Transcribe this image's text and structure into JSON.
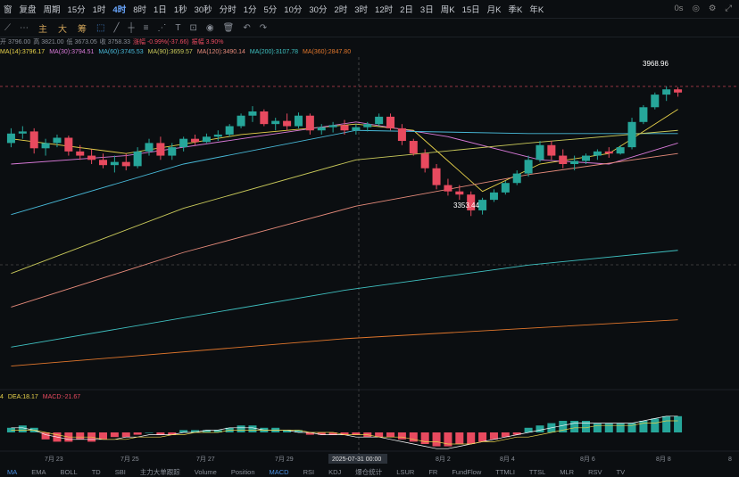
{
  "timeframes": {
    "items": [
      "窗",
      "复盘",
      "周期",
      "",
      "15分",
      "1时",
      "4时",
      "8时",
      "1日",
      "1秒",
      "30秒",
      "分时",
      "1分",
      "5分",
      "10分",
      "30分",
      "2时",
      "3时",
      "12时",
      "2日",
      "3日",
      "周K",
      "15日",
      "月K",
      "季K",
      "年K"
    ],
    "active_index": 6,
    "right_items": [
      "0s",
      "camera-icon",
      "settings-icon",
      "expand-icon"
    ]
  },
  "toolbar": {
    "indicators": [
      "主",
      "大",
      "筹"
    ]
  },
  "ohlc": {
    "open": "开 3796.00",
    "high": "高 3821.00",
    "low": "低 3673.05",
    "close": "收 3758.33",
    "change": "涨幅 -0.99%(-37.66)",
    "amp": "振幅 3.90%"
  },
  "ma_legend": [
    {
      "label": "MA(14):3796.17",
      "color": "#e8d24a"
    },
    {
      "label": "MA(30):3794.51",
      "color": "#d97ad9"
    },
    {
      "label": "MA(60):3745.53",
      "color": "#48b9d8"
    },
    {
      "label": "MA(90):3659.57",
      "color": "#c9c95a"
    },
    {
      "label": "MA(120):3490.14",
      "color": "#e58a7a"
    },
    {
      "label": "MA(200):3107.78",
      "color": "#3fc1c1"
    },
    {
      "label": "MA(360):2847.80",
      "color": "#e0762c"
    }
  ],
  "macd_legend": [
    {
      "label": "4",
      "color": "#e8d24a"
    },
    {
      "label": "DEA:18.17",
      "color": "#e8d24a"
    },
    {
      "label": "MACD:-21.67",
      "color": "#e84a5f"
    }
  ],
  "annotations": {
    "high_label": "3968.96",
    "low_label": "3353.44",
    "crosshair_time": "2025-07-31 00:00"
  },
  "x_axis_labels": [
    "7月 23",
    "7月 25",
    "7月 27",
    "7月 29",
    "8月 2",
    "8月 4",
    "8月 6",
    "8月 8",
    "8"
  ],
  "bottom_tabs": {
    "items": [
      "MA",
      "EMA",
      "BOLL",
      "TD",
      "SBI",
      "主力大单跟踪",
      "Volume",
      "Position",
      "MACD",
      "RSI",
      "KDJ",
      "爆仓统计",
      "LSUR",
      "FR",
      "FundFlow",
      "TTMLI",
      "TTSL",
      "MLR",
      "RSV",
      "TV"
    ],
    "active": [
      "MA",
      "MACD"
    ]
  },
  "colors": {
    "up": "#26a69a",
    "down": "#e84a5f",
    "accent": "#4a90e2"
  },
  "chart_data": {
    "type": "candlestick",
    "interval": "4h",
    "price_range": [
      2600,
      4100
    ],
    "price_min_label": "3353.44",
    "price_max_label": "3968.96",
    "candles": [
      {
        "t": "7月 22",
        "o": 3700,
        "h": 3770,
        "l": 3680,
        "c": 3745
      },
      {
        "t": "7月 22",
        "o": 3745,
        "h": 3780,
        "l": 3720,
        "c": 3755
      },
      {
        "t": "7月 23",
        "o": 3755,
        "h": 3770,
        "l": 3650,
        "c": 3675
      },
      {
        "t": "7月 23",
        "o": 3675,
        "h": 3720,
        "l": 3640,
        "c": 3700
      },
      {
        "t": "7月 23",
        "o": 3700,
        "h": 3740,
        "l": 3680,
        "c": 3725
      },
      {
        "t": "7月 23",
        "o": 3725,
        "h": 3735,
        "l": 3640,
        "c": 3660
      },
      {
        "t": "7月 24",
        "o": 3660,
        "h": 3690,
        "l": 3620,
        "c": 3640
      },
      {
        "t": "7月 24",
        "o": 3640,
        "h": 3670,
        "l": 3600,
        "c": 3620
      },
      {
        "t": "7月 24",
        "o": 3620,
        "h": 3650,
        "l": 3580,
        "c": 3595
      },
      {
        "t": "7月 24",
        "o": 3595,
        "h": 3640,
        "l": 3560,
        "c": 3610
      },
      {
        "t": "7月 25",
        "o": 3610,
        "h": 3650,
        "l": 3570,
        "c": 3590
      },
      {
        "t": "7月 25",
        "o": 3590,
        "h": 3680,
        "l": 3580,
        "c": 3660
      },
      {
        "t": "7月 25",
        "o": 3660,
        "h": 3720,
        "l": 3640,
        "c": 3700
      },
      {
        "t": "7月 25",
        "o": 3700,
        "h": 3730,
        "l": 3620,
        "c": 3640
      },
      {
        "t": "7月 26",
        "o": 3640,
        "h": 3700,
        "l": 3620,
        "c": 3680
      },
      {
        "t": "7月 26",
        "o": 3680,
        "h": 3730,
        "l": 3660,
        "c": 3720
      },
      {
        "t": "7月 26",
        "o": 3720,
        "h": 3740,
        "l": 3690,
        "c": 3705
      },
      {
        "t": "7月 26",
        "o": 3705,
        "h": 3745,
        "l": 3700,
        "c": 3730
      },
      {
        "t": "7月 27",
        "o": 3730,
        "h": 3760,
        "l": 3710,
        "c": 3740
      },
      {
        "t": "7月 27",
        "o": 3740,
        "h": 3790,
        "l": 3730,
        "c": 3780
      },
      {
        "t": "7月 27",
        "o": 3780,
        "h": 3840,
        "l": 3770,
        "c": 3830
      },
      {
        "t": "7月 28",
        "o": 3830,
        "h": 3875,
        "l": 3800,
        "c": 3850
      },
      {
        "t": "7月 28",
        "o": 3850,
        "h": 3860,
        "l": 3780,
        "c": 3790
      },
      {
        "t": "7月 28",
        "o": 3790,
        "h": 3820,
        "l": 3760,
        "c": 3805
      },
      {
        "t": "7月 29",
        "o": 3805,
        "h": 3840,
        "l": 3760,
        "c": 3780
      },
      {
        "t": "7月 29",
        "o": 3780,
        "h": 3845,
        "l": 3770,
        "c": 3830
      },
      {
        "t": "7月 29",
        "o": 3830,
        "h": 3840,
        "l": 3740,
        "c": 3760
      },
      {
        "t": "7月 30",
        "o": 3760,
        "h": 3790,
        "l": 3740,
        "c": 3775
      },
      {
        "t": "7月 30",
        "o": 3775,
        "h": 3800,
        "l": 3750,
        "c": 3785
      },
      {
        "t": "7月 30",
        "o": 3785,
        "h": 3810,
        "l": 3740,
        "c": 3760
      },
      {
        "t": "7月 31",
        "o": 3760,
        "h": 3790,
        "l": 3740,
        "c": 3775
      },
      {
        "t": "7月 31",
        "o": 3775,
        "h": 3800,
        "l": 3755,
        "c": 3790
      },
      {
        "t": "7月 31",
        "o": 3790,
        "h": 3840,
        "l": 3780,
        "c": 3825
      },
      {
        "t": "8月 1",
        "o": 3825,
        "h": 3840,
        "l": 3760,
        "c": 3770
      },
      {
        "t": "8月 1",
        "o": 3770,
        "h": 3790,
        "l": 3690,
        "c": 3710
      },
      {
        "t": "8月 1",
        "o": 3710,
        "h": 3720,
        "l": 3640,
        "c": 3650
      },
      {
        "t": "8月 2",
        "o": 3650,
        "h": 3670,
        "l": 3560,
        "c": 3580
      },
      {
        "t": "8月 2",
        "o": 3580,
        "h": 3600,
        "l": 3480,
        "c": 3500
      },
      {
        "t": "8月 2",
        "o": 3500,
        "h": 3530,
        "l": 3450,
        "c": 3470
      },
      {
        "t": "8月 3",
        "o": 3470,
        "h": 3500,
        "l": 3430,
        "c": 3455
      },
      {
        "t": "8月 3",
        "o": 3455,
        "h": 3470,
        "l": 3353,
        "c": 3380
      },
      {
        "t": "8月 3",
        "o": 3380,
        "h": 3440,
        "l": 3360,
        "c": 3430
      },
      {
        "t": "8月 4",
        "o": 3430,
        "h": 3480,
        "l": 3420,
        "c": 3465
      },
      {
        "t": "8月 4",
        "o": 3465,
        "h": 3520,
        "l": 3455,
        "c": 3510
      },
      {
        "t": "8月 4",
        "o": 3510,
        "h": 3570,
        "l": 3500,
        "c": 3555
      },
      {
        "t": "8月 5",
        "o": 3555,
        "h": 3640,
        "l": 3540,
        "c": 3620
      },
      {
        "t": "8月 5",
        "o": 3620,
        "h": 3710,
        "l": 3610,
        "c": 3690
      },
      {
        "t": "8月 5",
        "o": 3690,
        "h": 3710,
        "l": 3620,
        "c": 3640
      },
      {
        "t": "8月 6",
        "o": 3640,
        "h": 3670,
        "l": 3580,
        "c": 3600
      },
      {
        "t": "8月 6",
        "o": 3600,
        "h": 3640,
        "l": 3570,
        "c": 3615
      },
      {
        "t": "8月 6",
        "o": 3615,
        "h": 3650,
        "l": 3600,
        "c": 3640
      },
      {
        "t": "8月 7",
        "o": 3640,
        "h": 3670,
        "l": 3620,
        "c": 3660
      },
      {
        "t": "8月 7",
        "o": 3660,
        "h": 3680,
        "l": 3630,
        "c": 3650
      },
      {
        "t": "8月 7",
        "o": 3650,
        "h": 3690,
        "l": 3645,
        "c": 3680
      },
      {
        "t": "8月 8",
        "o": 3680,
        "h": 3820,
        "l": 3670,
        "c": 3800
      },
      {
        "t": "8月 8",
        "o": 3800,
        "h": 3880,
        "l": 3790,
        "c": 3870
      },
      {
        "t": "8月 8",
        "o": 3870,
        "h": 3940,
        "l": 3860,
        "c": 3930
      },
      {
        "t": "8月 9",
        "o": 3930,
        "h": 3968.96,
        "l": 3900,
        "c": 3955
      },
      {
        "t": "8月 9",
        "o": 3955,
        "h": 3965,
        "l": 3920,
        "c": 3940
      }
    ],
    "ma_series": [
      {
        "name": "MA(14)",
        "color": "#e8d24a",
        "values": [
          [
            0,
            3720
          ],
          [
            10,
            3650
          ],
          [
            20,
            3740
          ],
          [
            30,
            3790
          ],
          [
            35,
            3760
          ],
          [
            41,
            3470
          ],
          [
            46,
            3600
          ],
          [
            52,
            3650
          ],
          [
            58,
            3860
          ]
        ]
      },
      {
        "name": "MA(30)",
        "color": "#d97ad9",
        "values": [
          [
            0,
            3600
          ],
          [
            10,
            3640
          ],
          [
            20,
            3720
          ],
          [
            30,
            3800
          ],
          [
            38,
            3730
          ],
          [
            46,
            3620
          ],
          [
            52,
            3600
          ],
          [
            58,
            3700
          ]
        ]
      },
      {
        "name": "MA(60)",
        "color": "#48b9d8",
        "values": [
          [
            0,
            3360
          ],
          [
            15,
            3600
          ],
          [
            30,
            3760
          ],
          [
            45,
            3745
          ],
          [
            58,
            3745
          ]
        ]
      },
      {
        "name": "MA(90)",
        "color": "#c9c95a",
        "values": [
          [
            0,
            3080
          ],
          [
            15,
            3390
          ],
          [
            30,
            3620
          ],
          [
            45,
            3700
          ],
          [
            58,
            3760
          ]
        ]
      },
      {
        "name": "MA(120)",
        "color": "#e58a7a",
        "values": [
          [
            0,
            2920
          ],
          [
            15,
            3180
          ],
          [
            30,
            3400
          ],
          [
            45,
            3550
          ],
          [
            58,
            3650
          ]
        ]
      },
      {
        "name": "MA(200)",
        "color": "#3fc1c1",
        "values": [
          [
            0,
            2730
          ],
          [
            29,
            3000
          ],
          [
            45,
            3120
          ],
          [
            58,
            3190
          ]
        ]
      },
      {
        "name": "MA(360)",
        "color": "#e0762c",
        "values": [
          [
            0,
            2640
          ],
          [
            29,
            2770
          ],
          [
            58,
            2860
          ]
        ]
      }
    ],
    "macd_hist": [
      2,
      3,
      2,
      -3,
      -4,
      -4,
      -3,
      -4,
      -3,
      -2,
      -2,
      -1,
      0,
      -1,
      -1,
      1,
      1,
      1,
      1,
      2,
      3,
      3,
      2,
      2,
      1,
      1,
      -1,
      -1,
      -1,
      -1,
      -1,
      -2,
      -2,
      -2,
      -3,
      -4,
      -5,
      -6,
      -6,
      -5,
      -5,
      -4,
      -3,
      -2,
      -1,
      2,
      3,
      4,
      5,
      5,
      5,
      4,
      4,
      4,
      4,
      5,
      6,
      7,
      7
    ],
    "dif": [
      2,
      2,
      1,
      -1,
      -2,
      -3,
      -3,
      -3,
      -3,
      -3,
      -2,
      -2,
      -1,
      -1,
      -1,
      0,
      0,
      1,
      1,
      2,
      2,
      2,
      1,
      1,
      1,
      0,
      0,
      -1,
      -1,
      -1,
      -2,
      -2,
      -2,
      -3,
      -4,
      -5,
      -6,
      -7,
      -7,
      -6,
      -5,
      -4,
      -3,
      -2,
      -1,
      0,
      1,
      2,
      3,
      4,
      4,
      4,
      4,
      4,
      4,
      5,
      6,
      7,
      7
    ],
    "dea": [
      1,
      1,
      1,
      0,
      -1,
      -2,
      -2,
      -2,
      -3,
      -3,
      -3,
      -2,
      -2,
      -2,
      -1,
      -1,
      0,
      0,
      0,
      1,
      1,
      1,
      1,
      1,
      1,
      1,
      0,
      0,
      0,
      -1,
      -1,
      -1,
      -2,
      -2,
      -2,
      -3,
      -4,
      -4,
      -5,
      -5,
      -5,
      -4,
      -4,
      -3,
      -2,
      -2,
      -1,
      0,
      1,
      2,
      2,
      3,
      3,
      3,
      3,
      4,
      4,
      5,
      5
    ]
  }
}
